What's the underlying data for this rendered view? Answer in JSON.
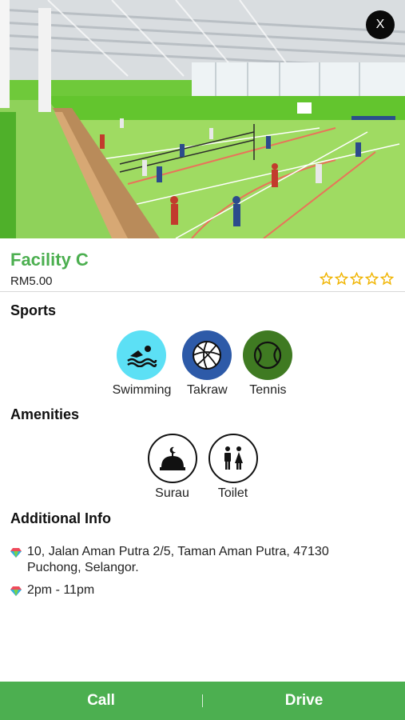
{
  "header": {
    "close_label": "X"
  },
  "facility": {
    "name": "Facility C",
    "price": "RM5.00",
    "rating": 0,
    "rating_max": 5,
    "star_color": "#f0b400"
  },
  "sports": {
    "title": "Sports",
    "items": [
      {
        "label": "Swimming",
        "icon": "swimmer-icon",
        "color": "#5ce0f5"
      },
      {
        "label": "Takraw",
        "icon": "takraw-ball-icon",
        "color": "#2d5aa8"
      },
      {
        "label": "Tennis",
        "icon": "tennis-ball-icon",
        "color": "#3f7a22"
      }
    ]
  },
  "amenities": {
    "title": "Amenities",
    "items": [
      {
        "label": "Surau",
        "icon": "mosque-dome-icon"
      },
      {
        "label": "Toilet",
        "icon": "toilet-people-icon"
      }
    ]
  },
  "additional_info": {
    "title": "Additional Info",
    "address": "10, Jalan Aman Putra 2/5, Taman Aman Putra, 47130 Puchong, Selangor.",
    "hours": "2pm - 11pm"
  },
  "actions": {
    "call_label": "Call",
    "drive_label": "Drive"
  },
  "colors": {
    "accent": "#4caf50",
    "divider": "#d8d8d8"
  }
}
